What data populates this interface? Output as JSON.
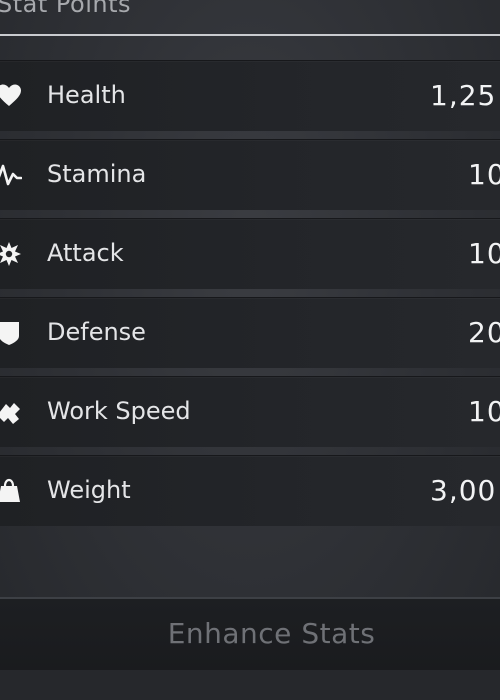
{
  "header": {
    "title": "Stat Points"
  },
  "stats": [
    {
      "icon": "heart-icon",
      "label": "Health",
      "value": "1,25"
    },
    {
      "icon": "stamina-wave-icon",
      "label": "Stamina",
      "value": "10"
    },
    {
      "icon": "burst-icon",
      "label": "Attack",
      "value": "10"
    },
    {
      "icon": "shield-icon",
      "label": "Defense",
      "value": "20"
    },
    {
      "icon": "work-speed-icon",
      "label": "Work Speed",
      "value": "10"
    },
    {
      "icon": "weight-bag-icon",
      "label": "Weight",
      "value": "3,00"
    }
  ],
  "actions": {
    "enhance_label": "Enhance Stats"
  },
  "colors": {
    "background": "#2b2d31",
    "row": "#222427",
    "text": "#e4e5e7",
    "disabled_text": "#6f7176"
  }
}
